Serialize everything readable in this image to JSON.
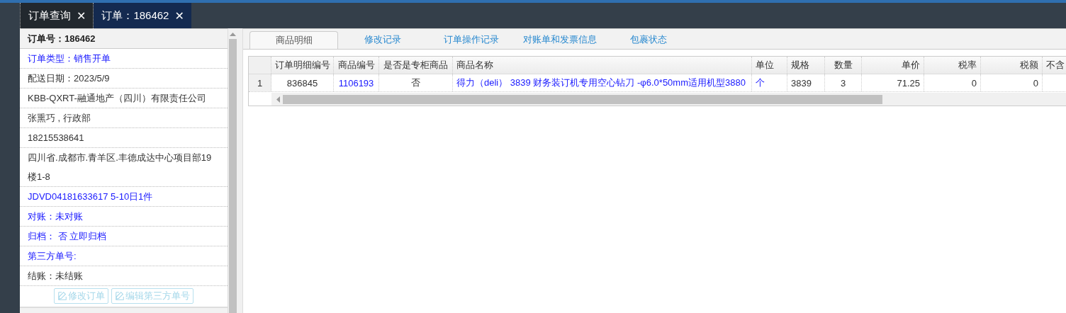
{
  "top_tabs": [
    {
      "label": "订单查询",
      "close": "✕",
      "selected": false
    },
    {
      "label": "订单：186462",
      "close": "✕",
      "selected": true
    }
  ],
  "order_panel": {
    "title": "订单号：186462",
    "rows": [
      {
        "text": "订单类型：销售开单",
        "kind": "link"
      },
      {
        "text": "配送日期：2023/5/9",
        "kind": "plain"
      },
      {
        "text": "KBB-QXRT-融通地产（四川）有限责任公司",
        "kind": "plain"
      },
      {
        "text": "张熏巧 , 行政部",
        "kind": "plain"
      },
      {
        "text": "18215538641",
        "kind": "plain"
      },
      {
        "text": "四川省.成都市.青羊区.丰德成达中心项目部19楼1-8",
        "kind": "plain"
      },
      {
        "text": "JDVD04181633617 5-10日1件",
        "kind": "link"
      },
      {
        "text": "对账：未对账",
        "kind": "link"
      },
      {
        "text": "归档： 否 立即归档",
        "kind": "link"
      },
      {
        "text": "第三方单号:",
        "kind": "link"
      },
      {
        "text": "结账：未结账",
        "kind": "plain"
      }
    ],
    "buttons": [
      {
        "label": "修改订单",
        "disabled": true
      },
      {
        "label": "编辑第三方单号",
        "disabled": true
      }
    ]
  },
  "detail_tabs": [
    {
      "label": "商品明细",
      "selected": true
    },
    {
      "label": "修改记录",
      "selected": false
    },
    {
      "label": "订单操作记录",
      "selected": false
    },
    {
      "label": "对账单和发票信息",
      "selected": false
    },
    {
      "label": "包裹状态",
      "selected": false
    }
  ],
  "table": {
    "columns": [
      "订单明细编号",
      "商品编号",
      "是否是专柜商品",
      "商品名称",
      "单位",
      "规格",
      "数量",
      "单价",
      "税率",
      "税额",
      "不含"
    ],
    "rows": [
      {
        "index": "1",
        "cells": [
          {
            "text": "836845",
            "link": false
          },
          {
            "text": "1106193",
            "link": true
          },
          {
            "text": "否",
            "link": false
          },
          {
            "text": "得力（deli） 3839 财务装订机专用空心钻刀 -φ6.0*50mm适用机型3880",
            "link": true
          },
          {
            "text": "个",
            "link": true
          },
          {
            "text": "3839",
            "link": false
          },
          {
            "text": "3",
            "link": false
          },
          {
            "text": "71.25",
            "link": false
          },
          {
            "text": "0",
            "link": false
          },
          {
            "text": "0",
            "link": false
          }
        ]
      }
    ]
  }
}
